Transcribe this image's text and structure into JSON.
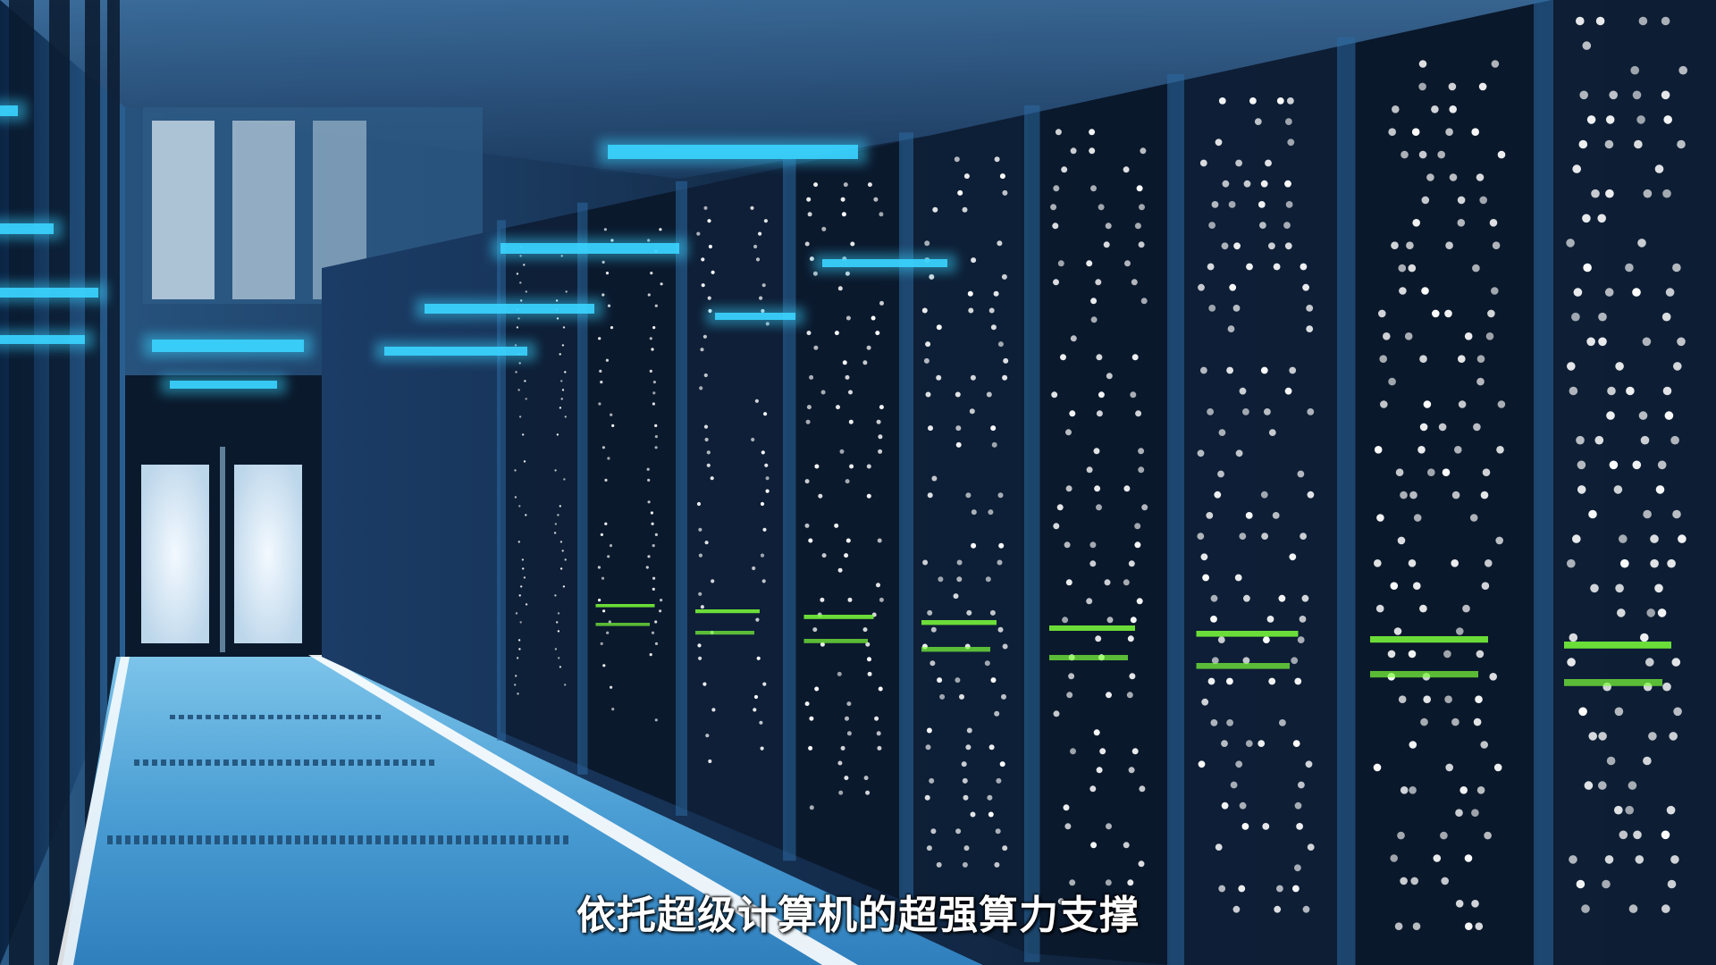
{
  "video_frame": {
    "subtitle": "依托超级计算机的超强算力支撑"
  },
  "palette": {
    "ceiling_glow": "#3ad4ff",
    "rack_dark": "#0a1526",
    "floor_blue": "#4aa3d9",
    "led_white": "#ffffff",
    "led_green": "#7dff3a",
    "door_light": "#e8f2f8"
  }
}
